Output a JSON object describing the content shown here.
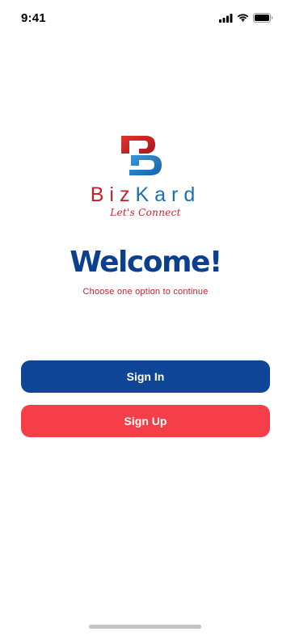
{
  "status_bar": {
    "time": "9:41",
    "icons": [
      "cellular-signal-icon",
      "wifi-icon",
      "battery-icon"
    ]
  },
  "brand": {
    "logo_icon": "bizkard-b-logo-icon",
    "name_part1": "Biz",
    "name_part2": "Kard",
    "tagline": "Let's Connect",
    "colors": {
      "red": "#c8202b",
      "blue": "#1b6fb3"
    }
  },
  "welcome": {
    "title": "Welcome!",
    "subtitle": "Choose one option to continue"
  },
  "actions": {
    "sign_in_label": "Sign In",
    "sign_up_label": "Sign Up",
    "sign_in_color": "#0e4596",
    "sign_up_color": "#f53e48"
  }
}
